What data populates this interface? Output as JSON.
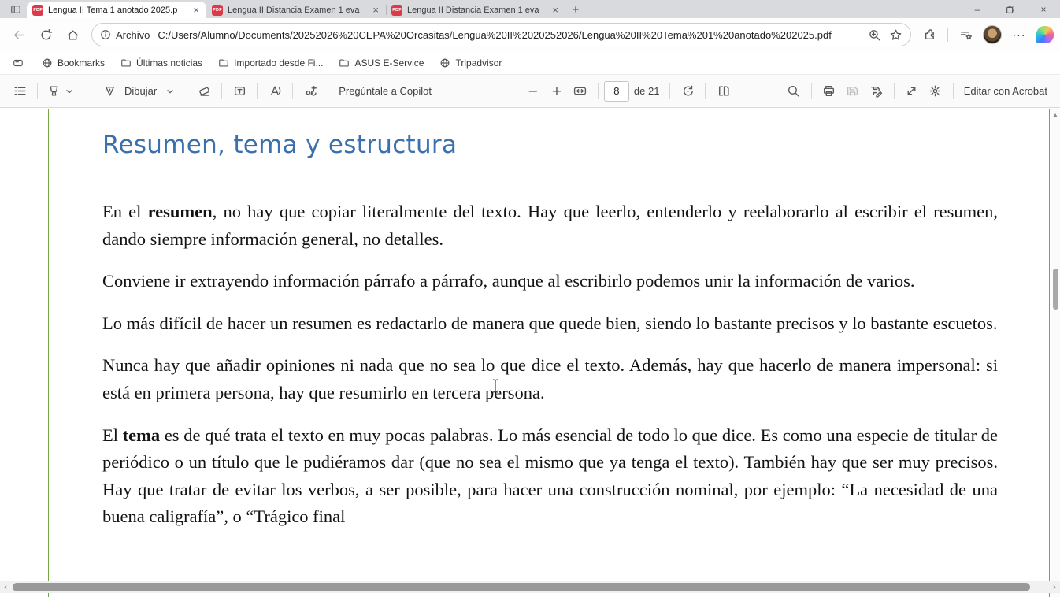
{
  "tab_strip": {
    "tabs": [
      {
        "title": "Lengua II Tema 1 anotado 2025.p",
        "badge": "PDF"
      },
      {
        "title": "Lengua II Distancia Examen 1 eva",
        "badge": "PDF"
      },
      {
        "title": "Lengua II Distancia Examen 1 eva",
        "badge": "PDF"
      }
    ],
    "close_glyph": "×",
    "new_tab_glyph": "+"
  },
  "window_controls": {
    "minimize_glyph": "–",
    "close_glyph": "×"
  },
  "address_bar": {
    "protocol_label": "Archivo",
    "url": "C:/Users/Alumno/Documents/20252026%20CEPA%20Orcasitas/Lengua%20II%2020252026/Lengua%20II%20Tema%201%20anotado%202025.pdf",
    "more_glyph": "···"
  },
  "bookmarks_bar": {
    "items": [
      {
        "label": "Bookmarks"
      },
      {
        "label": "Últimas noticias"
      },
      {
        "label": "Importado desde Fi..."
      },
      {
        "label": "ASUS E-Service"
      },
      {
        "label": "Tripadvisor"
      }
    ]
  },
  "pdf_toolbar": {
    "draw_label": "Dibujar",
    "copilot_label": "Pregúntale a Copilot",
    "zoom_out_glyph": "−",
    "zoom_in_glyph": "+",
    "page_number": "8",
    "page_total_label": "de 21",
    "acrobat_label": "Editar con Acrobat"
  },
  "document": {
    "heading": "Resumen, tema y estructura",
    "p1": {
      "pre": "En el ",
      "bold": "resumen",
      "rest": ", no hay que copiar literalmente del texto. Hay que leerlo, entenderlo y reelaborarlo al escribir el resumen, dando siempre información general, no detalles."
    },
    "p2": "Conviene ir extrayendo información párrafo a párrafo, aunque al escribirlo podemos unir la información de varios.",
    "p3": "Lo más difícil de hacer un resumen es redactarlo de manera que quede bien, siendo lo bastante precisos y lo bastante escuetos.",
    "p4": "Nunca hay que añadir opiniones ni nada que no sea lo que dice el texto. Además, hay que hacerlo de manera impersonal: si está en primera persona, hay que resumirlo en tercera persona.",
    "p5": {
      "pre": "El ",
      "bold": "tema",
      "rest": " es de qué trata el texto en muy pocas palabras. Lo más esencial de todo lo que dice. Es como una especie de titular de periódico o un título que le pudiéramos dar (que no sea el mismo que ya tenga el texto). También hay que ser muy precisos. Hay que tratar de evitar los verbos, a ser posible, para hacer una construcción nominal, por ejemplo: “La necesidad de una buena caligrafía”, o “Trágico final"
    }
  },
  "colors": {
    "heading_blue": "#3a70ac",
    "notebook_green": "#73a646",
    "pdf_red": "#da3b4b"
  }
}
